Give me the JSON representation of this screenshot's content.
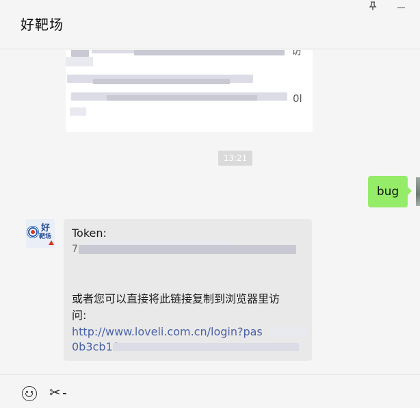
{
  "header": {
    "title": "好靶场"
  },
  "window_controls": {
    "pin_icon": "pin-icon",
    "minimize_icon": "minimize-icon"
  },
  "chat": {
    "top_message": {
      "visible_fragments": [
        "访",
        "0l"
      ]
    },
    "timestamp": "13:21",
    "outgoing_message": {
      "text": "bug"
    },
    "incoming_message": {
      "sender_avatar_text": "好靶场",
      "token_label": "Token:",
      "token_partial": "7",
      "instruction_text_line1": "或者您可以直接将此链接复制到浏览器里访",
      "instruction_text_line2": "问:",
      "link_text": "http://www.loveli.com.cn/login?pas",
      "link_partial_start": "0b3cb10"
    }
  },
  "footer": {
    "emoji_icon": "emoji-icon",
    "screenshot_icon": "scissors-icon"
  },
  "colors": {
    "background": "#f5f5f5",
    "outgoing_bubble": "#95ec69",
    "incoming_bubble": "#e9e9e9",
    "link": "#4a62a7",
    "timestamp_bg": "#dadada"
  }
}
